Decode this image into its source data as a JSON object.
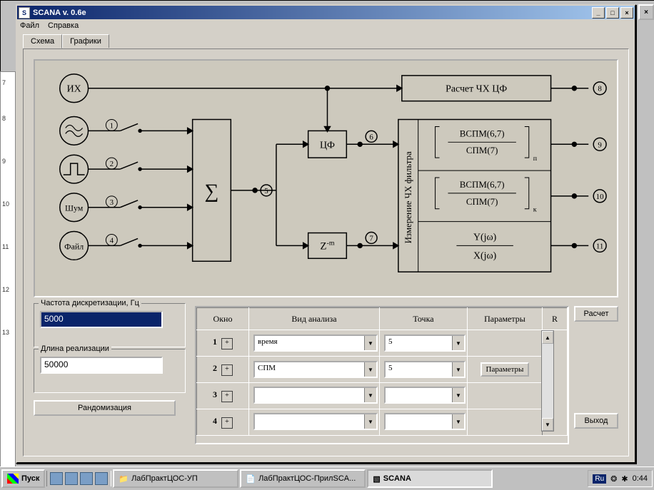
{
  "window": {
    "title": "SCANA v. 0.6e",
    "menu": {
      "file": "Файл",
      "help": "Справка"
    },
    "tabs": {
      "scheme": "Схема",
      "graphs": "Графики"
    }
  },
  "diagram": {
    "sources": {
      "ih": "ИХ",
      "noise": "Шум",
      "file": "Файл"
    },
    "sum": "∑",
    "filter": "ЦФ",
    "delay": "Z⁻ᵐ",
    "calc_box": "Расчет ЧХ ЦФ",
    "measure_box": "Измерение ЧХ фильтра",
    "frac1_top": "ВСПМ(6,7)",
    "frac1_bot": "СПМ(7)",
    "sub_p": "п",
    "frac2_top": "ВСПМ(6,7)",
    "frac2_bot": "СПМ(7)",
    "sub_k": "к",
    "frac3_top": "Y(jω)",
    "frac3_bot": "X(jω)",
    "nodes": {
      "n1": "1",
      "n2": "2",
      "n3": "3",
      "n4": "4",
      "n5": "5",
      "n6": "6",
      "n7": "7",
      "n8": "8",
      "n9": "9",
      "n10": "10",
      "n11": "11"
    }
  },
  "params": {
    "fs_label": "Частота дискретизации, Гц",
    "fs_value": "5000",
    "len_label": "Длина реализации",
    "len_value": "50000",
    "randomize": "Рандомизация"
  },
  "grid": {
    "headers": {
      "window": "Окно",
      "analysis": "Вид анализа",
      "point": "Точка",
      "params": "Параметры",
      "r": "R"
    },
    "rows": [
      {
        "n": "1",
        "analysis": "время",
        "point": "5",
        "params": ""
      },
      {
        "n": "2",
        "analysis": "СПМ",
        "point": "5",
        "params": "Параметры"
      },
      {
        "n": "3",
        "analysis": "",
        "point": "",
        "params": ""
      },
      {
        "n": "4",
        "analysis": "",
        "point": "",
        "params": ""
      }
    ]
  },
  "buttons": {
    "calc": "Расчет",
    "exit": "Выход"
  },
  "taskbar": {
    "start": "Пуск",
    "items": [
      {
        "label": "ЛабПрактЦОС-УП"
      },
      {
        "label": "ЛабПрактЦОС-ПрилSCA..."
      },
      {
        "label": "SCANA"
      }
    ],
    "lang": "Ru",
    "time": "0:44"
  },
  "ruler": [
    "7",
    "8",
    "9",
    "10",
    "11",
    "12",
    "13"
  ]
}
